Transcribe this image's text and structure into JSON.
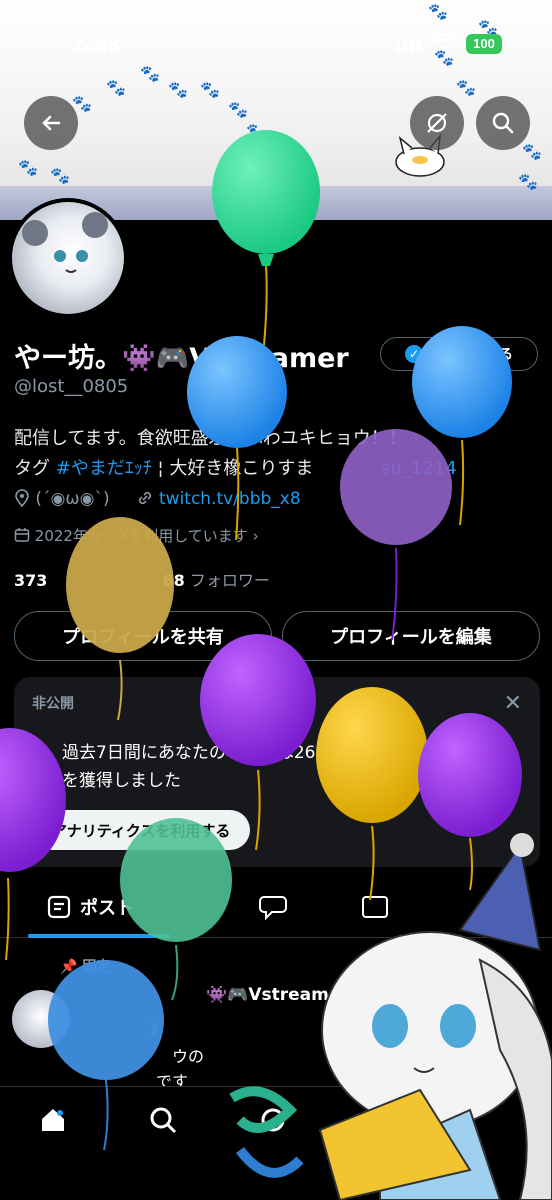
{
  "status_bar": {
    "time": "5:48",
    "battery": "100"
  },
  "profile": {
    "display_name": "やー坊。👾🎮Vstreamer",
    "verify_label": "認証を受ける",
    "handle": "@lost__0805",
    "bio_line1": "配信してます。食欲旺盛ぷよふわユキヒョウ！！",
    "bio_line2_prefix": "タグ ",
    "bio_hashtag": "#やまだｴｯﾁ",
    "bio_line2_mid": " ¦ 大好き橡こりすま",
    "bio_mention": "su_1214",
    "location": "(´◉ω◉`)",
    "link": "twitch.tv/bbb_x8",
    "joined": "2022年からXを利用しています",
    "following_count": "373",
    "followers_count": "68",
    "followers_label": "フォロワー",
    "share_button": "プロフィールを共有",
    "edit_button": "プロフィールを編集"
  },
  "private_card": {
    "title": "非公開",
    "message": "過去7日間にあなたのポストは2610件のインプレッションを獲得しました",
    "button": "アナリティクスを利用する"
  },
  "tabs": [
    {
      "label": "ポスト"
    }
  ],
  "post": {
    "pinned_label": "固定",
    "author": "👾🎮Vstream",
    "line1": "》",
    "line2": "ウの",
    "line3": "です"
  },
  "colors": {
    "accent": "#1d9bf0",
    "background": "#000000",
    "muted": "#8b98a5"
  }
}
